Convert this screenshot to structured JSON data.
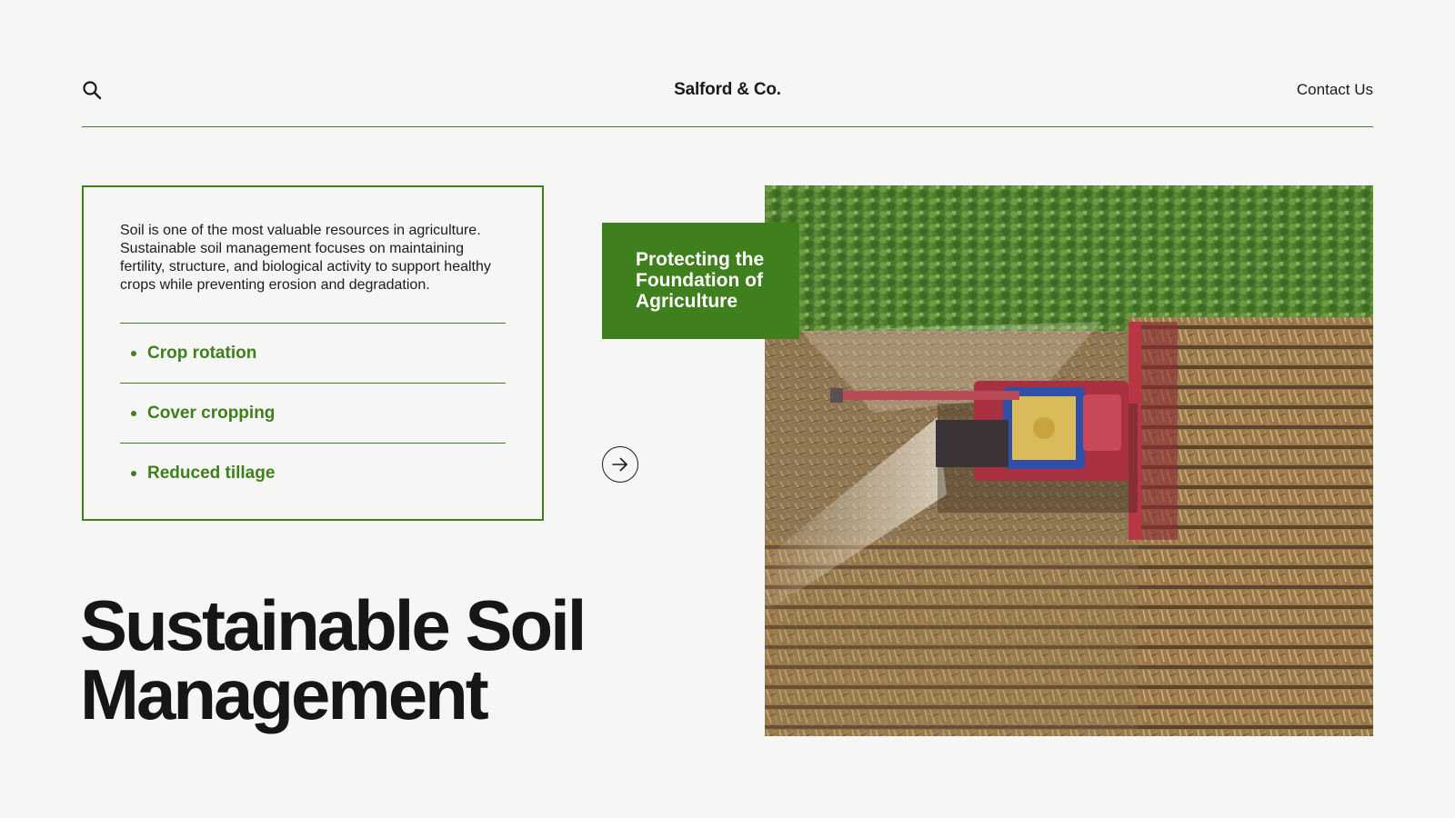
{
  "header": {
    "brand": "Salford & Co.",
    "contact_label": "Contact Us",
    "search_icon": "search-icon"
  },
  "info_card": {
    "paragraph": "Soil is one of the most valuable resources in agriculture. Sustainable soil management focuses on maintaining fertility, structure, and biological activity to support healthy crops while preventing erosion and degradation.",
    "items": [
      {
        "label": "Crop rotation"
      },
      {
        "label": "Cover cropping"
      },
      {
        "label": "Reduced tillage"
      }
    ]
  },
  "title": {
    "line1": "Sustainable Soil",
    "line2": "Management"
  },
  "tag": {
    "text": "Protecting the Foundation of Agriculture"
  },
  "arrow_icon": "arrow-right-icon",
  "colors": {
    "accent": "#3f7f1d",
    "background": "#f6f6f4",
    "text": "#1a1a1a"
  }
}
